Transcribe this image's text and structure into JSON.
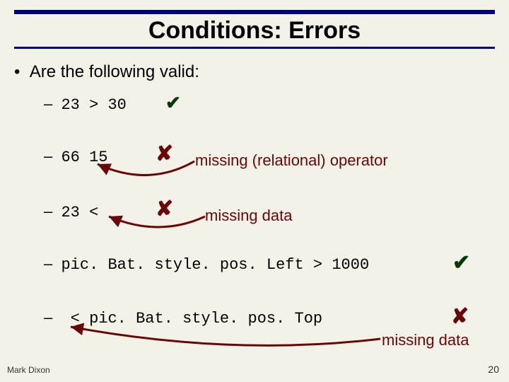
{
  "title": "Conditions: Errors",
  "question": "Are the following valid:",
  "items": [
    {
      "code": "23 > 30"
    },
    {
      "code": "66 15"
    },
    {
      "code": "23 <"
    },
    {
      "code": "pic. Bat. style. pos. Left > 1000"
    },
    {
      "code": " < pic. Bat. style. pos. Top"
    }
  ],
  "notes": {
    "missing_operator": "missing (relational) operator",
    "missing_data": "missing data"
  },
  "marks": {
    "check": "✔",
    "cross": "✘"
  },
  "footer": {
    "author": "Mark Dixon",
    "page": "20"
  }
}
